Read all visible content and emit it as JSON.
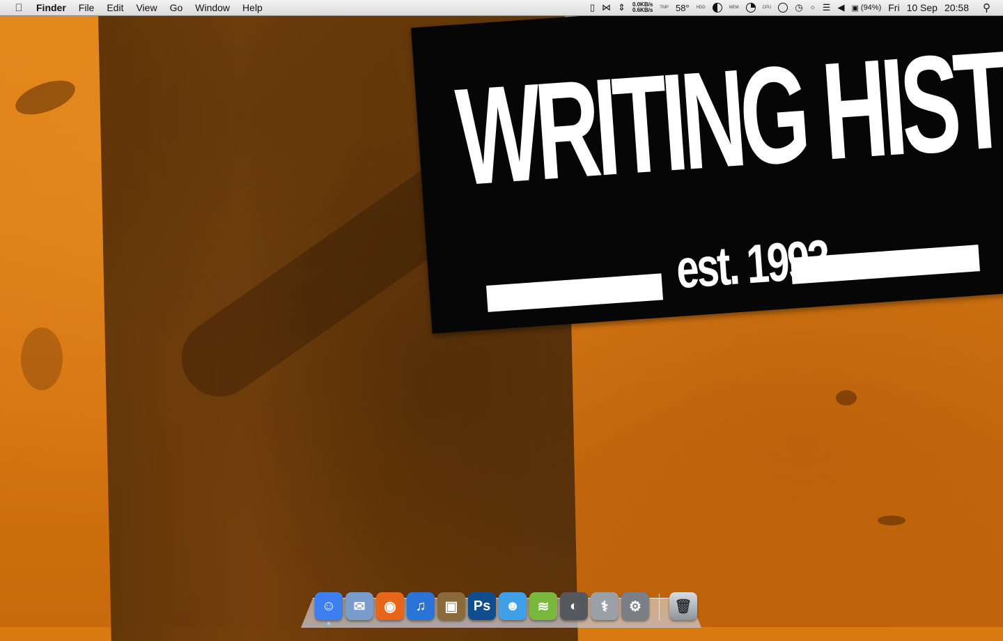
{
  "menubar": {
    "app_name": "Finder",
    "menus": [
      "File",
      "Edit",
      "View",
      "Go",
      "Window",
      "Help"
    ],
    "status": {
      "network_up": "0.0KB/s",
      "network_down": "0.6KB/s",
      "temp_label": "TMP",
      "temperature": "58°",
      "hdd_label": "HDD",
      "mem_label": "MEM",
      "cpu_label": "CPU",
      "battery": "(94%)",
      "day": "Fri",
      "date": "10 Sep",
      "time": "20:58"
    }
  },
  "wallpaper": {
    "title": "WRITING HISTORY",
    "subtitle": "est. 1993"
  },
  "dock": {
    "apps": [
      {
        "name": "finder",
        "glyph": "☺",
        "color": "#3d7ff0"
      },
      {
        "name": "mail",
        "glyph": "✉",
        "color": "#7a9ccc"
      },
      {
        "name": "firefox",
        "glyph": "◉",
        "color": "#e8661a"
      },
      {
        "name": "itunes",
        "glyph": "♫",
        "color": "#2a74d8"
      },
      {
        "name": "iphoto",
        "glyph": "▣",
        "color": "#8a6a3a"
      },
      {
        "name": "photoshop",
        "glyph": "Ps",
        "color": "#0f4d8e"
      },
      {
        "name": "messenger",
        "glyph": "☻",
        "color": "#3fa0e8"
      },
      {
        "name": "spotify",
        "glyph": "≋",
        "color": "#79b83a"
      },
      {
        "name": "steam",
        "glyph": "◐",
        "color": "#55595e"
      },
      {
        "name": "disk-utility",
        "glyph": "⚕",
        "color": "#9aa0a6"
      },
      {
        "name": "system-preferences",
        "glyph": "⚙",
        "color": "#7a7f86"
      }
    ],
    "trash_glyph": "🗑"
  }
}
